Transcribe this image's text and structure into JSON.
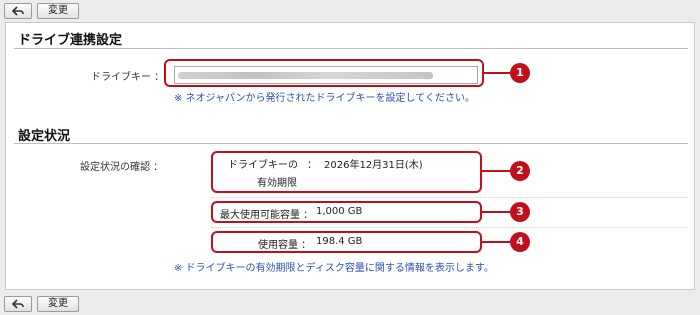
{
  "toolbar": {
    "change_label": "変更"
  },
  "drive": {
    "section_title": "ドライブ連携設定",
    "key_label": "ドライブキー ：",
    "key_note": "※ ネオジャパンから発行されたドライブキーを設定してください。"
  },
  "status": {
    "section_title": "設定状況",
    "confirm_label": "設定状況の確認 ：",
    "expiry_label_line1": "ドライブキーの",
    "expiry_label_line2": "有効期限",
    "expiry_sep": "：",
    "expiry_value": "2026年12月31日(木)",
    "max_capacity_label": "最大使用可能容量 ：",
    "max_capacity_value": "1,000 GB",
    "used_capacity_label": "使用容量 ：",
    "used_capacity_value": "198.4 GB",
    "note": "※ ドライブキーの有効期限とディスク容量に関する情報を表示します。"
  },
  "callouts": [
    "1",
    "2",
    "3",
    "4"
  ],
  "colors": {
    "highlight": "#c0101c",
    "note_text": "#2a4fb8"
  }
}
